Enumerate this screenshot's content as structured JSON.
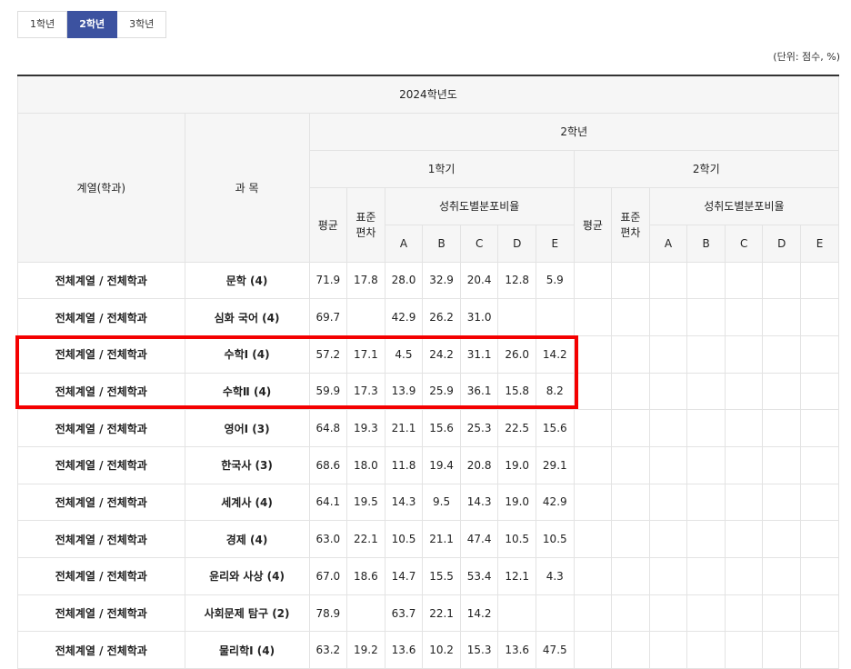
{
  "tabs": [
    "1학년",
    "2학년",
    "3학년"
  ],
  "active_tab": 1,
  "unit_note": "(단위: 점수, %)",
  "header": {
    "year": "2024학년도",
    "col_dept": "계열(학과)",
    "col_subject": "과 목",
    "grade": "2학년",
    "sem1": "1학기",
    "sem2": "2학기",
    "avg": "평균",
    "std_line1": "표준",
    "std_line2": "편차",
    "dist": "성취도별분포비율",
    "grades": [
      "A",
      "B",
      "C",
      "D",
      "E"
    ]
  },
  "rows": [
    {
      "dept": "전체계열 / 전체학과",
      "subject": "문학 (4)",
      "s1": [
        "71.9",
        "17.8",
        "28.0",
        "32.9",
        "20.4",
        "12.8",
        "5.9"
      ]
    },
    {
      "dept": "전체계열 / 전체학과",
      "subject": "심화 국어 (4)",
      "s1": [
        "69.7",
        "",
        "42.9",
        "26.2",
        "31.0",
        "",
        ""
      ]
    },
    {
      "dept": "전체계열 / 전체학과",
      "subject": "수학Ⅰ (4)",
      "s1": [
        "57.2",
        "17.1",
        "4.5",
        "24.2",
        "31.1",
        "26.0",
        "14.2"
      ]
    },
    {
      "dept": "전체계열 / 전체학과",
      "subject": "수학Ⅱ (4)",
      "s1": [
        "59.9",
        "17.3",
        "13.9",
        "25.9",
        "36.1",
        "15.8",
        "8.2"
      ]
    },
    {
      "dept": "전체계열 / 전체학과",
      "subject": "영어Ⅰ (3)",
      "s1": [
        "64.8",
        "19.3",
        "21.1",
        "15.6",
        "25.3",
        "22.5",
        "15.6"
      ]
    },
    {
      "dept": "전체계열 / 전체학과",
      "subject": "한국사 (3)",
      "s1": [
        "68.6",
        "18.0",
        "11.8",
        "19.4",
        "20.8",
        "19.0",
        "29.1"
      ]
    },
    {
      "dept": "전체계열 / 전체학과",
      "subject": "세계사 (4)",
      "s1": [
        "64.1",
        "19.5",
        "14.3",
        "9.5",
        "14.3",
        "19.0",
        "42.9"
      ]
    },
    {
      "dept": "전체계열 / 전체학과",
      "subject": "경제 (4)",
      "s1": [
        "63.0",
        "22.1",
        "10.5",
        "21.1",
        "47.4",
        "10.5",
        "10.5"
      ]
    },
    {
      "dept": "전체계열 / 전체학과",
      "subject": "윤리와 사상 (4)",
      "s1": [
        "67.0",
        "18.6",
        "14.7",
        "15.5",
        "53.4",
        "12.1",
        "4.3"
      ]
    },
    {
      "dept": "전체계열 / 전체학과",
      "subject": "사회문제 탐구 (2)",
      "s1": [
        "78.9",
        "",
        "63.7",
        "22.1",
        "14.2",
        "",
        ""
      ]
    },
    {
      "dept": "전체계열 / 전체학과",
      "subject": "물리학Ⅰ (4)",
      "s1": [
        "63.2",
        "19.2",
        "13.6",
        "10.2",
        "15.3",
        "13.6",
        "47.5"
      ]
    }
  ]
}
